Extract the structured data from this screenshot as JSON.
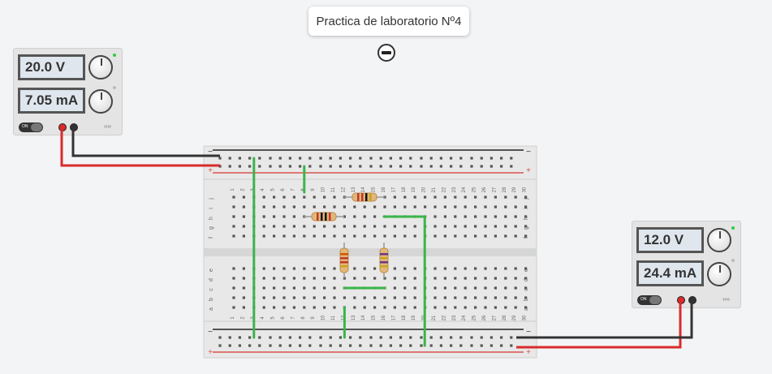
{
  "title": {
    "text": "Practica de laboratorio Nº4"
  },
  "controls": {
    "collapse_icon": "minus-circle-icon"
  },
  "power_supply_left": {
    "voltage": "20.0 V",
    "current": "7.05 mA",
    "switch_label": "ON"
  },
  "power_supply_right": {
    "voltage": "12.0 V",
    "current": "24.4 mA",
    "switch_label": "ON"
  },
  "breadboard": {
    "columns": [
      "1",
      "2",
      "3",
      "4",
      "5",
      "6",
      "7",
      "8",
      "9",
      "10",
      "11",
      "12",
      "13",
      "14",
      "15",
      "16",
      "17",
      "18",
      "19",
      "20",
      "21",
      "22",
      "23",
      "24",
      "25",
      "26",
      "27",
      "28",
      "29",
      "30"
    ],
    "rows_top": [
      "j",
      "i",
      "h",
      "g",
      "f"
    ],
    "rows_bottom": [
      "e",
      "d",
      "c",
      "b",
      "a"
    ],
    "rail_minus": "−",
    "rail_plus": "+"
  },
  "colors": {
    "wire_red": "#d92b2b",
    "wire_black": "#333333",
    "jumper_green": "#3ab54a",
    "rail_red": "#d9534f",
    "rail_blue": "#222222"
  }
}
